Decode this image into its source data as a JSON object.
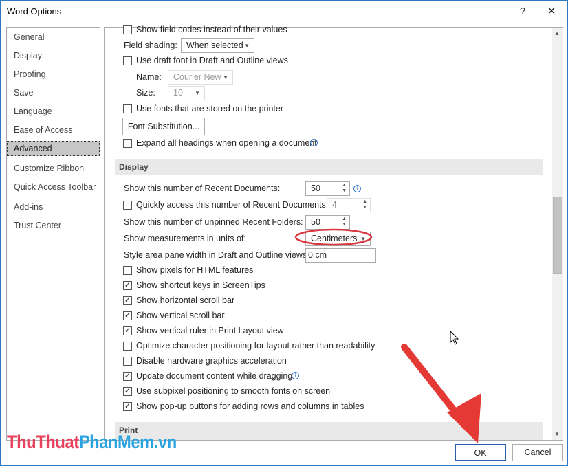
{
  "window": {
    "title": "Word Options",
    "help": "?",
    "close": "✕"
  },
  "sidebar": {
    "items": [
      {
        "label": "General"
      },
      {
        "label": "Display"
      },
      {
        "label": "Proofing"
      },
      {
        "label": "Save"
      },
      {
        "label": "Language"
      },
      {
        "label": "Ease of Access"
      },
      {
        "label": "Advanced",
        "selected": true
      },
      {
        "label": "Customize Ribbon"
      },
      {
        "label": "Quick Access Toolbar"
      },
      {
        "label": "Add-ins"
      },
      {
        "label": "Trust Center"
      }
    ]
  },
  "content": {
    "show_field_codes": {
      "label": "Show field codes instead of their values",
      "checked": false
    },
    "field_shading": {
      "label": "Field shading:",
      "value": "When selected"
    },
    "draft_font": {
      "label": "Use draft font in Draft and Outline views",
      "checked": false
    },
    "name": {
      "label": "Name:",
      "value": "Courier New"
    },
    "size": {
      "label": "Size:",
      "value": "10"
    },
    "printer_fonts": {
      "label": "Use fonts that are stored on the printer",
      "checked": false
    },
    "font_substitution": "Font Substitution...",
    "expand_headings": {
      "label": "Expand all headings when opening a document",
      "checked": false
    },
    "display_header": "Display",
    "recent_docs": {
      "label": "Show this number of Recent Documents:",
      "value": "50"
    },
    "quick_access": {
      "label": "Quickly access this number of Recent Documents:",
      "value": "4",
      "checked": false
    },
    "recent_folders": {
      "label": "Show this number of unpinned Recent Folders:",
      "value": "50"
    },
    "units": {
      "label": "Show measurements in units of:",
      "value": "Centimeters"
    },
    "style_area": {
      "label": "Style area pane width in Draft and Outline views:",
      "value": "0 cm"
    },
    "display_options": [
      {
        "label": "Show pixels for HTML features",
        "checked": false
      },
      {
        "label": "Show shortcut keys in ScreenTips",
        "checked": true
      },
      {
        "label": "Show horizontal scroll bar",
        "checked": true
      },
      {
        "label": "Show vertical scroll bar",
        "checked": true
      },
      {
        "label": "Show vertical ruler in Print Layout view",
        "checked": true
      },
      {
        "label": "Optimize character positioning for layout rather than readability",
        "checked": false
      },
      {
        "label": "Disable hardware graphics acceleration",
        "checked": false
      },
      {
        "label": "Update document content while dragging",
        "checked": true,
        "info": true
      },
      {
        "label": "Use subpixel positioning to smooth fonts on screen",
        "checked": true
      },
      {
        "label": "Show pop-up buttons for adding rows and columns in tables",
        "checked": true
      }
    ],
    "print_header": "Print"
  },
  "footer": {
    "ok": "OK",
    "cancel": "Cancel"
  },
  "watermark": {
    "part1": "ThuThuat",
    "part2": "PhanMem.vn",
    "color1": "#e8415b",
    "color2": "#2aa3e0"
  },
  "annotation_color": "#e53935"
}
